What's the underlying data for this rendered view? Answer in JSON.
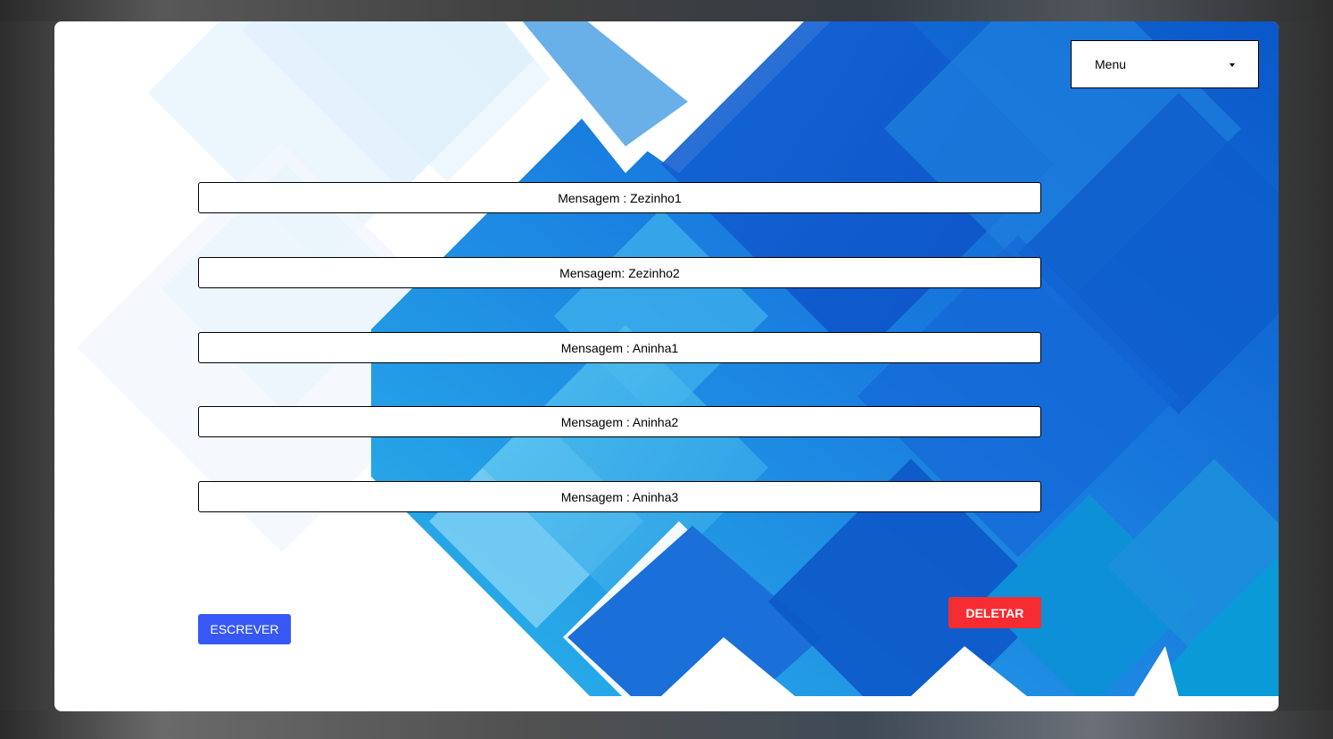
{
  "menu": {
    "label": "Menu"
  },
  "messages": [
    "Mensagem : Zezinho1",
    "Mensagem: Zezinho2",
    "Mensagem : Aninha1",
    "Mensagem : Aninha2",
    "Mensagem : Aninha3"
  ],
  "actions": {
    "write_label": "ESCREVER",
    "delete_label": "DELETAR"
  },
  "colors": {
    "write_button": "#3858f5",
    "delete_button": "#f52d32",
    "background_blue": "#1a73d9"
  }
}
